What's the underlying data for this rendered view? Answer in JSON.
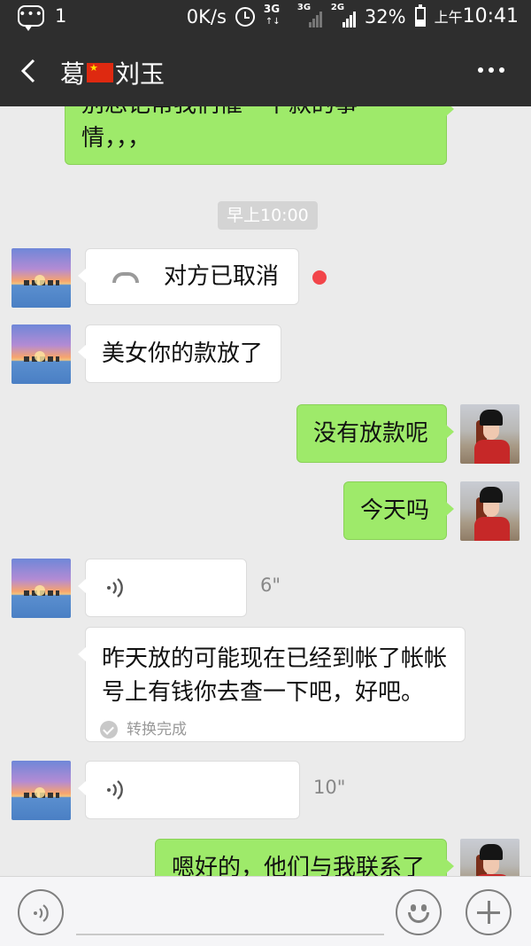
{
  "status_bar": {
    "notification_count": "1",
    "net_speed": "0K/s",
    "network_1": "3G",
    "network_2": "3G",
    "network_3": "2G",
    "battery": "32%",
    "time_prefix": "上午",
    "time": "10:41",
    "battery_level": 0.32
  },
  "header": {
    "title_part1": "葛",
    "title_part2": "刘玉",
    "back_icon": "chevron-left-icon",
    "more_icon": "more-horizontal-icon",
    "flag_icon": "china-flag-icon"
  },
  "messages": {
    "top_partial": "别忘记帮我们催一下款的事",
    "top_line2": "情，，，",
    "timestamp": "早上10:00",
    "call_text": "对方已取消",
    "msg_money": "美女你的款放了",
    "reply_no": "没有放款呢",
    "reply_today": "今天吗",
    "voice1_duration": "6\"",
    "transcription": "昨天放的可能现在已经到帐了帐帐号上有钱你去查一下吧，好吧。",
    "conversion_status": "转换完成",
    "voice2_duration": "10\"",
    "bottom_partial": "嗯好的，他们与我联系了"
  },
  "colors": {
    "header_bg": "#2e2e2e",
    "chat_bg": "#ebebeb",
    "out_bubble": "#9eea6a",
    "in_bubble": "#ffffff",
    "unread_dot": "#f2454a"
  },
  "input_bar": {
    "voice_icon": "voice-mode-icon",
    "emoji_icon": "smile-icon",
    "more_icon": "plus-icon"
  }
}
